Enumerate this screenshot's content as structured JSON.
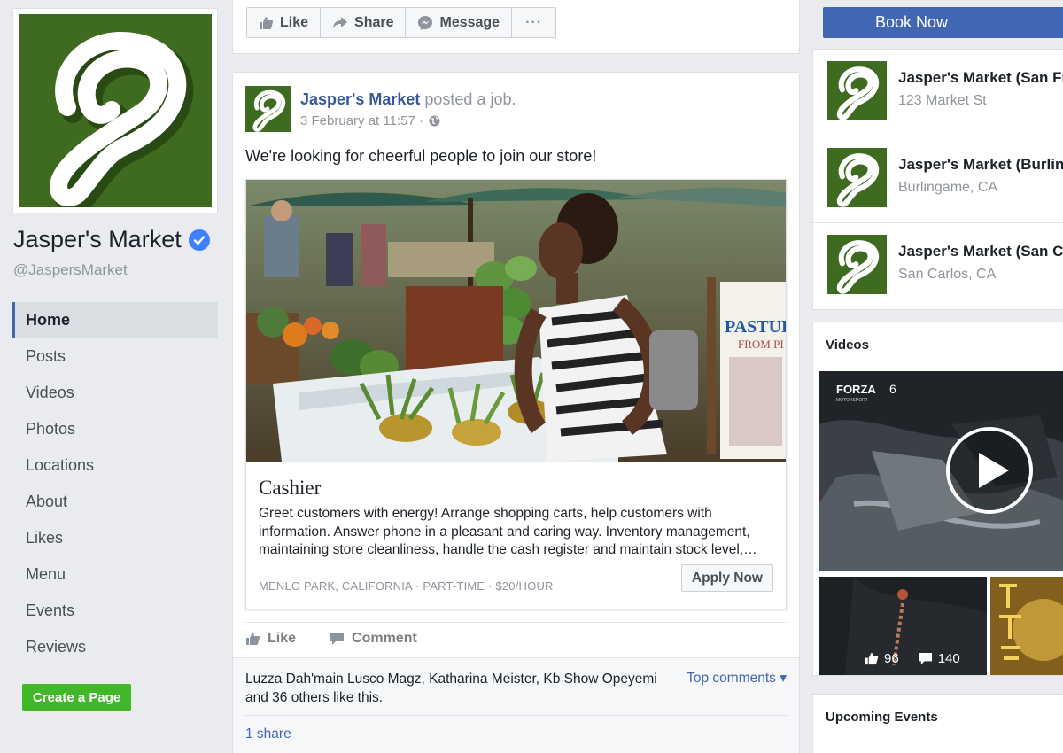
{
  "page": {
    "name": "Jasper's Market",
    "handle": "@JaspersMarket",
    "brand_color": "#3f6b21",
    "verified": true
  },
  "nav": {
    "items": [
      {
        "label": "Home",
        "active": true
      },
      {
        "label": "Posts"
      },
      {
        "label": "Videos"
      },
      {
        "label": "Photos"
      },
      {
        "label": "Locations"
      },
      {
        "label": "About"
      },
      {
        "label": "Likes"
      },
      {
        "label": "Menu"
      },
      {
        "label": "Events"
      },
      {
        "label": "Reviews"
      }
    ],
    "create_page_label": "Create a Page"
  },
  "actions": {
    "like": "Like",
    "share": "Share",
    "message": "Message",
    "more": "···",
    "book_now": "Book Now"
  },
  "post": {
    "author": "Jasper's Market",
    "verb": "posted a job.",
    "timestamp": "3 February at 11:57 ·",
    "text": "We're looking for cheerful people to join our store!",
    "job": {
      "title": "Cashier",
      "description": "Greet customers with energy! Arrange shopping carts, help customers with information. Answer phone in a pleasant and caring way. Inventory management, maintaining store cleanliness, handle the cash register and maintain stock level,…",
      "meta": "MENLO PARK, CALIFORNIA · PART-TIME · $20/HOUR",
      "apply_label": "Apply Now",
      "photo_sign": "PASTUR",
      "photo_sign2": "FROM PI"
    },
    "like_label": "Like",
    "comment_label": "Comment",
    "likes_summary": "Luzza Dah'main Lusco Magz, Katharina Meister, Kb Show Opeyemi and 36 others like this.",
    "top_comments_label": "Top comments ▾",
    "shares_label": "1 share"
  },
  "locations": [
    {
      "name": "Jasper's Market (San Fr",
      "address": "123 Market St"
    },
    {
      "name": "Jasper's Market (Burlin",
      "address": "Burlingame, CA"
    },
    {
      "name": "Jasper's Market (San Ca",
      "address": "San Carlos, CA"
    }
  ],
  "videos": {
    "title": "Videos",
    "main_video_brand": "FORZA",
    "main_video_num": "6",
    "main_video_sub": "MOTORSPORT",
    "small_video": {
      "likes": "96",
      "comments": "140"
    }
  },
  "events": {
    "title": "Upcoming Events"
  }
}
